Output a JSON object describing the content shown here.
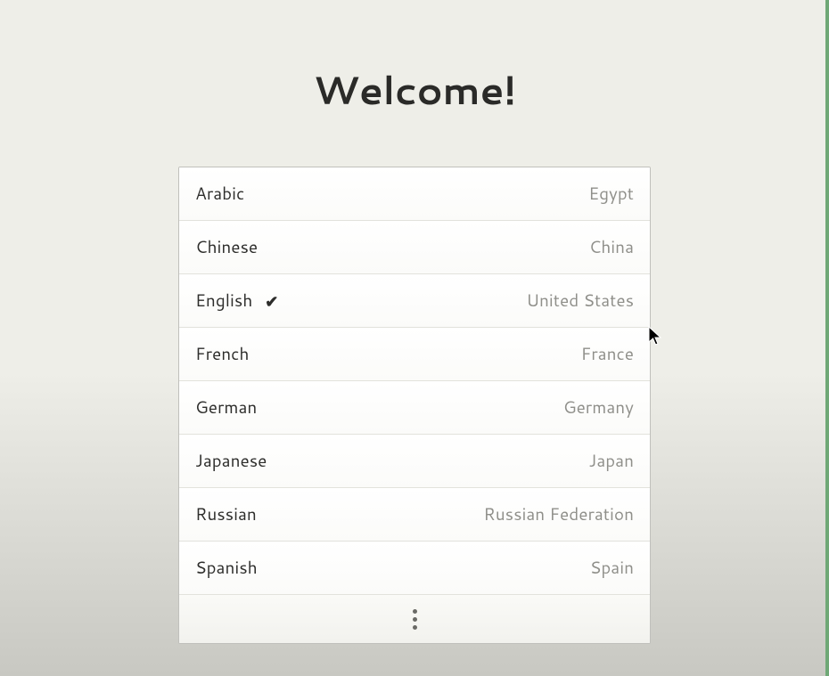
{
  "title": "Welcome!",
  "languages": [
    {
      "name": "Arabic",
      "region": "Egypt",
      "selected": false
    },
    {
      "name": "Chinese",
      "region": "China",
      "selected": false
    },
    {
      "name": "English",
      "region": "United States",
      "selected": true
    },
    {
      "name": "French",
      "region": "France",
      "selected": false
    },
    {
      "name": "German",
      "region": "Germany",
      "selected": false
    },
    {
      "name": "Japanese",
      "region": "Japan",
      "selected": false
    },
    {
      "name": "Russian",
      "region": "Russian Federation",
      "selected": false
    },
    {
      "name": "Spanish",
      "region": "Spain",
      "selected": false
    }
  ]
}
